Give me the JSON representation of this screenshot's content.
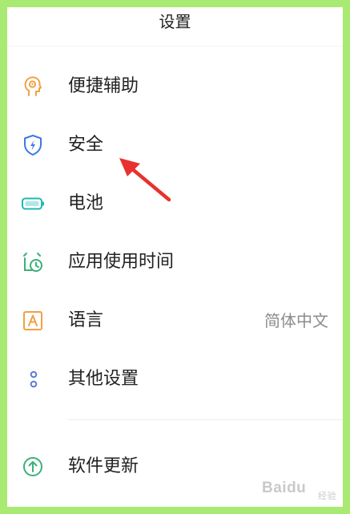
{
  "header": {
    "title": "设置"
  },
  "items": [
    {
      "label": "便捷辅助",
      "icon": "accessibility-head-icon",
      "color": "#f0a144"
    },
    {
      "label": "安全",
      "icon": "shield-icon",
      "color": "#3d78e6"
    },
    {
      "label": "电池",
      "icon": "battery-icon",
      "color": "#21b7b1"
    },
    {
      "label": "应用使用时间",
      "icon": "alarm-clock-icon",
      "color": "#3ab07a"
    },
    {
      "label": "语言",
      "icon": "language-a-icon",
      "color": "#f0a144",
      "value": "简体中文"
    },
    {
      "label": "其他设置",
      "icon": "more-dots-icon",
      "color": "#5a7bd6"
    },
    {
      "label": "软件更新",
      "icon": "update-arrow-icon",
      "color": "#3ab07a"
    }
  ],
  "annotation": {
    "arrow_color": "#e8322f"
  },
  "watermark": {
    "text": "Baidu",
    "sub": "经验"
  }
}
